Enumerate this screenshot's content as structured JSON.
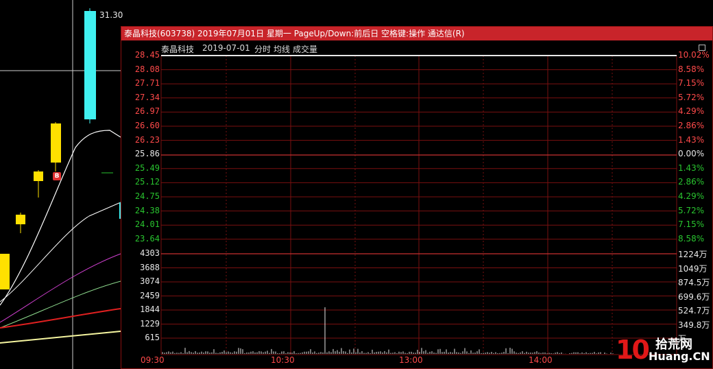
{
  "window": {
    "title": "泰晶科技(603738) 2019年07月01日 星期一 PageUp/Down:前后日 空格键:操作 通达信(R)",
    "subheader": {
      "stock_name": "泰晶科技",
      "date": "2019-07-01",
      "chart_type": "分时",
      "avg_line": "均线",
      "volume": "成交量"
    }
  },
  "background_kline": {
    "top_price_label": "31.30",
    "signal_badge": "B"
  },
  "price_axis": {
    "left": [
      {
        "value": "28.45",
        "color": "red"
      },
      {
        "value": "28.08",
        "color": "red"
      },
      {
        "value": "27.71",
        "color": "red"
      },
      {
        "value": "27.34",
        "color": "red"
      },
      {
        "value": "26.97",
        "color": "red"
      },
      {
        "value": "26.60",
        "color": "red"
      },
      {
        "value": "26.23",
        "color": "red"
      },
      {
        "value": "25.86",
        "color": "white"
      },
      {
        "value": "25.49",
        "color": "green"
      },
      {
        "value": "25.12",
        "color": "green"
      },
      {
        "value": "24.75",
        "color": "green"
      },
      {
        "value": "24.38",
        "color": "green"
      },
      {
        "value": "24.01",
        "color": "green"
      },
      {
        "value": "23.64",
        "color": "green"
      }
    ],
    "right": [
      {
        "value": "10.02%",
        "color": "red"
      },
      {
        "value": "8.58%",
        "color": "red"
      },
      {
        "value": "7.15%",
        "color": "red"
      },
      {
        "value": "5.72%",
        "color": "red"
      },
      {
        "value": "4.29%",
        "color": "red"
      },
      {
        "value": "2.86%",
        "color": "red"
      },
      {
        "value": "1.43%",
        "color": "red"
      },
      {
        "value": "0.00%",
        "color": "white"
      },
      {
        "value": "1.43%",
        "color": "green"
      },
      {
        "value": "2.86%",
        "color": "green"
      },
      {
        "value": "4.29%",
        "color": "green"
      },
      {
        "value": "5.72%",
        "color": "green"
      },
      {
        "value": "7.15%",
        "color": "green"
      },
      {
        "value": "8.58%",
        "color": "green"
      }
    ]
  },
  "volume_axis": {
    "left": [
      "4303",
      "3688",
      "3074",
      "2459",
      "1844",
      "1229",
      "615"
    ],
    "right": [
      "1224万",
      "1049万",
      "874.5万",
      "699.6万",
      "524.7万",
      "349.8万",
      "万"
    ]
  },
  "time_axis": [
    "09:30",
    "10:30",
    "13:00",
    "14:00"
  ],
  "watermark": {
    "number": "10",
    "cn_text": "拾荒网",
    "en_text": "Huang.CN"
  },
  "colors": {
    "title_bar": "#c8242a",
    "grid": "#8a1010",
    "up": "#ff4a4a",
    "down": "#29c42f",
    "flat": "#e8e8e8"
  }
}
